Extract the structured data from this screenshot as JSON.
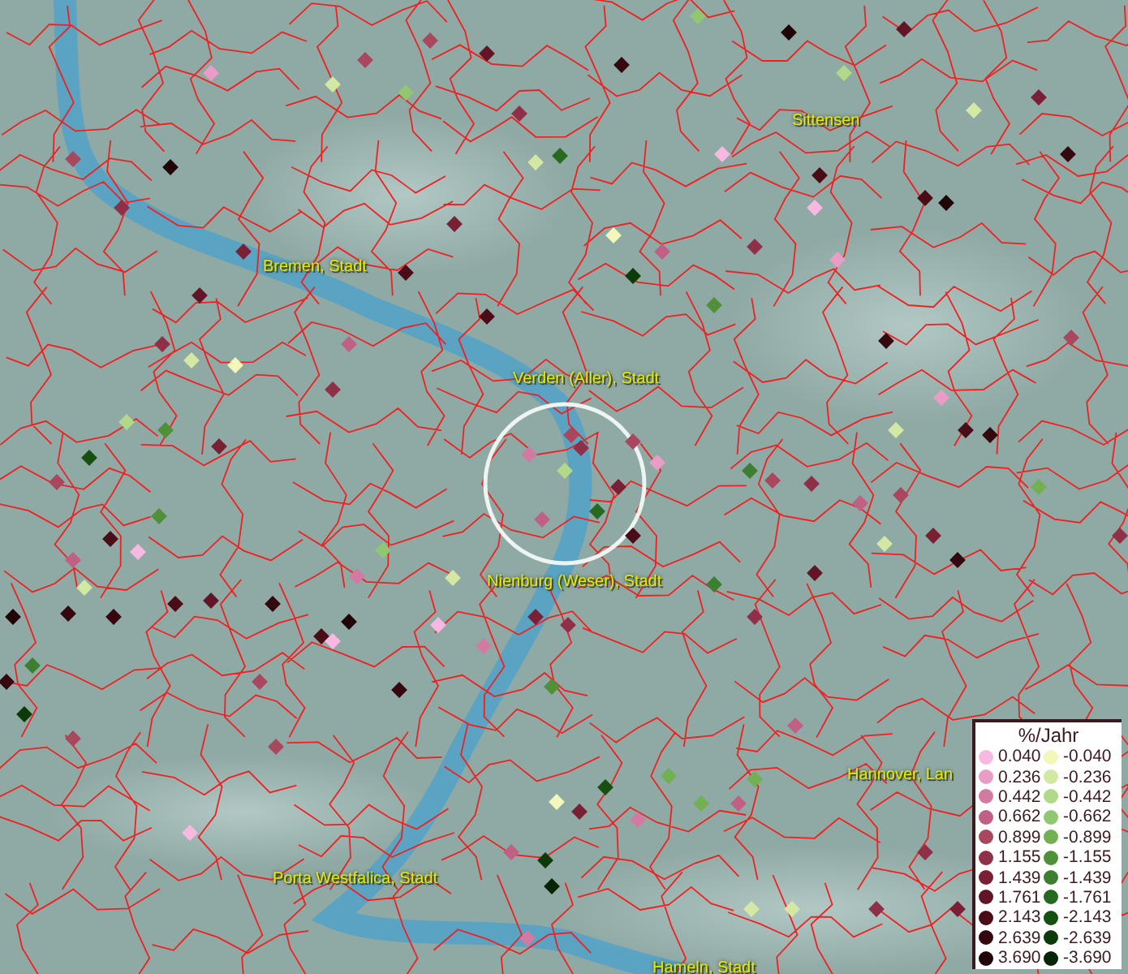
{
  "map_labels": [
    {
      "text": "Sittensen"
    },
    {
      "text": "Bremen, Stadt"
    },
    {
      "text": "Verden (Aller), Stadt"
    },
    {
      "text": "Nienburg (Weser), Stadt"
    },
    {
      "text": "Hannover, Lan"
    },
    {
      "text": "Porta Westfalica, Stadt"
    },
    {
      "text": "Hameln, Stadt"
    }
  ],
  "legend": {
    "title": "%/Jahr",
    "increase": [
      {
        "label": "0.040",
        "color": "#f7b8e2"
      },
      {
        "label": "0.236",
        "color": "#e89cc6"
      },
      {
        "label": "0.442",
        "color": "#d27aa2"
      },
      {
        "label": "0.662",
        "color": "#c06085"
      },
      {
        "label": "0.899",
        "color": "#a9475f"
      },
      {
        "label": "1.155",
        "color": "#8f3048"
      },
      {
        "label": "1.439",
        "color": "#7a2035"
      },
      {
        "label": "1.761",
        "color": "#611526"
      },
      {
        "label": "2.143",
        "color": "#4a0d18"
      },
      {
        "label": "2.639",
        "color": "#350810"
      },
      {
        "label": "3.690",
        "color": "#210408"
      }
    ],
    "decrease": [
      {
        "label": "-0.040",
        "color": "#f2f7bc"
      },
      {
        "label": "-0.236",
        "color": "#d3e8a2"
      },
      {
        "label": "-0.442",
        "color": "#b2d98a"
      },
      {
        "label": "-0.662",
        "color": "#92c772"
      },
      {
        "label": "-0.899",
        "color": "#72b052"
      },
      {
        "label": "-1.155",
        "color": "#4f9038"
      },
      {
        "label": "-1.439",
        "color": "#3d7f30"
      },
      {
        "label": "-1.761",
        "color": "#266a20"
      },
      {
        "label": "-2.143",
        "color": "#155010"
      },
      {
        "label": "-2.639",
        "color": "#0c3a08"
      },
      {
        "label": "-3.690",
        "color": "#062504"
      }
    ]
  }
}
